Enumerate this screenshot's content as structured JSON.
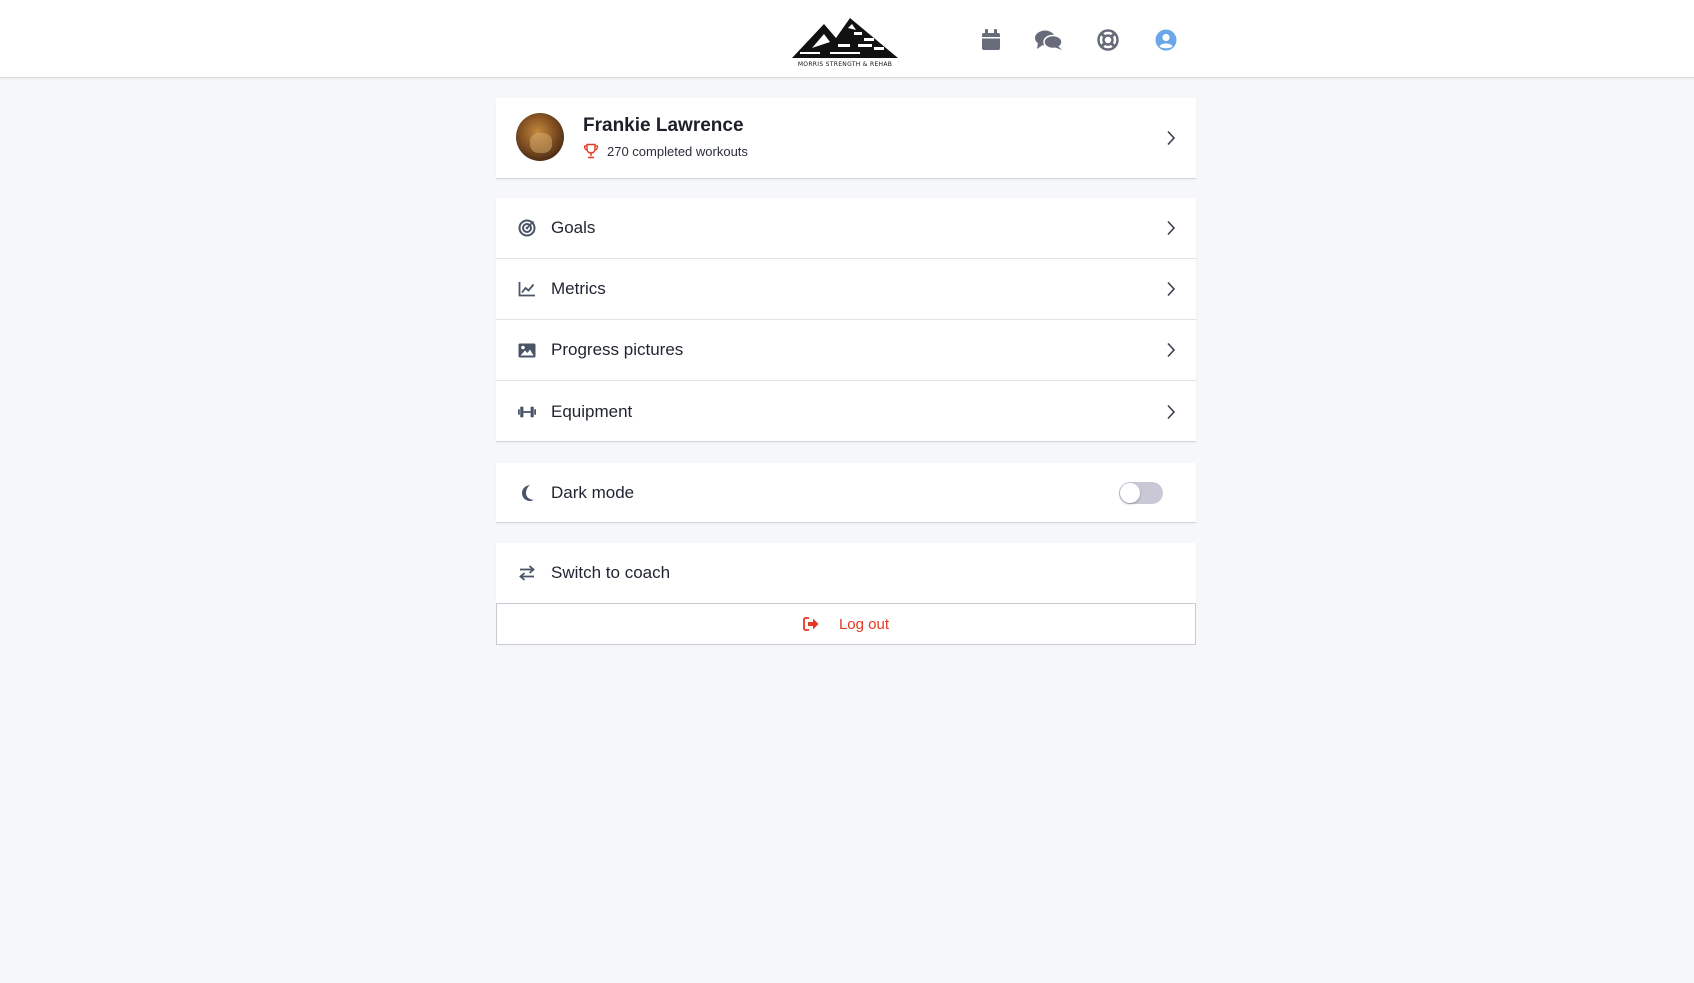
{
  "header": {
    "logo_text": "MORRIS STRENGTH & REHAB",
    "nav": [
      {
        "icon": "calendar-icon"
      },
      {
        "icon": "chat-icon"
      },
      {
        "icon": "lifebuoy-icon"
      },
      {
        "icon": "user-circle-icon",
        "active_color": "#6aa6e8"
      }
    ]
  },
  "profile": {
    "name": "Frankie Lawrence",
    "workouts": "270 completed workouts",
    "trophy_color": "#e23a22"
  },
  "menu": {
    "items": [
      {
        "label": "Goals",
        "icon": "target-icon"
      },
      {
        "label": "Metrics",
        "icon": "line-chart-icon"
      },
      {
        "label": "Progress pictures",
        "icon": "image-icon"
      },
      {
        "label": "Equipment",
        "icon": "dumbbell-icon"
      }
    ]
  },
  "settings": {
    "dark_mode_label": "Dark mode",
    "dark_mode_enabled": false,
    "switch_label": "Switch to coach",
    "logout_label": "Log out"
  },
  "colors": {
    "accent": "#e23a22",
    "icon": "#4a5467",
    "background": "#f6f7f9"
  }
}
